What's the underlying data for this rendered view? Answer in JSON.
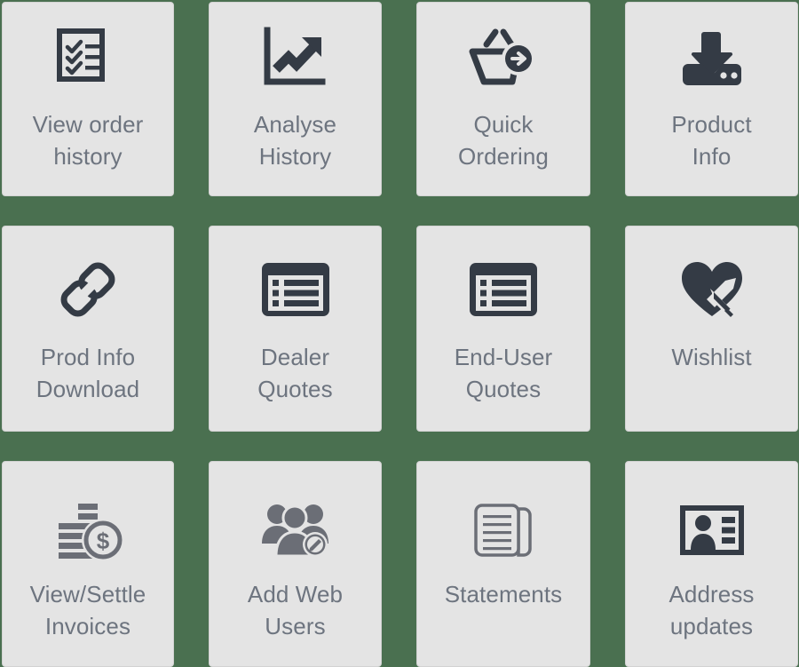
{
  "theme": {
    "background_color": "#4a7050",
    "tile_background_color": "#e4e4e4",
    "tile_border_color": "#d2d2d2",
    "label_text_color": "#6d747f",
    "icon_dark_color": "#343b45",
    "icon_gray_color": "#6b6e76"
  },
  "grid": {
    "columns": 4,
    "rows": 3,
    "tiles": [
      {
        "label": "View order\nhistory",
        "icon": "checklist-icon",
        "icon_color": "#343b45"
      },
      {
        "label": "Analyse\nHistory",
        "icon": "growth-chart-icon",
        "icon_color": "#343b45"
      },
      {
        "label": "Quick\nOrdering",
        "icon": "basket-arrow-icon",
        "icon_color": "#343b45"
      },
      {
        "label": "Product\nInfo",
        "icon": "download-inbox-icon",
        "icon_color": "#343b45"
      },
      {
        "label": "Prod Info\nDownload",
        "icon": "chain-link-icon",
        "icon_color": "#343b45"
      },
      {
        "label": "Dealer\nQuotes",
        "icon": "list-window-icon",
        "icon_color": "#343b45"
      },
      {
        "label": "End-User\nQuotes",
        "icon": "list-window-icon",
        "icon_color": "#343b45"
      },
      {
        "label": "Wishlist",
        "icon": "heart-pen-icon",
        "icon_color": "#343b45"
      },
      {
        "label": "View/Settle\nInvoices",
        "icon": "coins-dollar-icon",
        "icon_color": "#6b6e76"
      },
      {
        "label": "Add Web\nUsers",
        "icon": "users-edit-icon",
        "icon_color": "#6b6e76"
      },
      {
        "label": "Statements",
        "icon": "documents-icon",
        "icon_color": "#6b6e76"
      },
      {
        "label": "Address\nupdates",
        "icon": "id-card-icon",
        "icon_color": "#343b45"
      }
    ]
  }
}
